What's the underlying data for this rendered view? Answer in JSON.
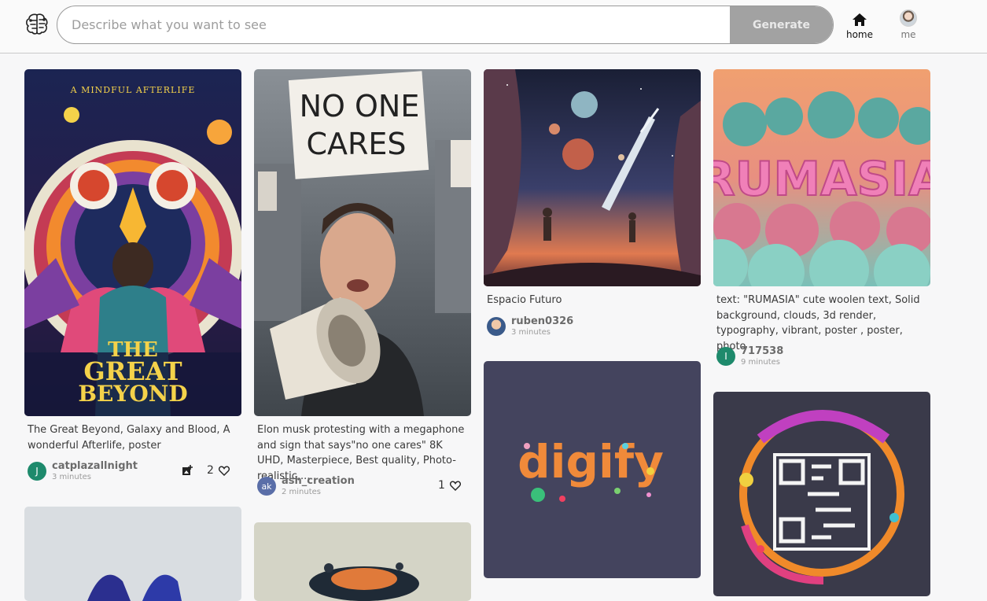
{
  "header": {
    "search_placeholder": "Describe what you want to see",
    "generate_label": "Generate",
    "nav": {
      "home_label": "home",
      "me_label": "me"
    }
  },
  "cards": [
    {
      "caption": "The Great Beyond, Galaxy and Blood, A wonderful Afterlife, poster",
      "user": "catplazallnight",
      "avatar_letter": "J",
      "avatar_color": "#1e8a6c",
      "time": "3 minutes",
      "likes": "2",
      "image_desc": "poster-great-beyond"
    },
    {
      "caption": "Elon musk protesting with a megaphone and sign that says\"no one cares\" 8K UHD, Masterpiece, Best quality, Photo-realistic,...",
      "user": "ash_creation",
      "avatar_letter": "ak",
      "avatar_color": "#5a6ea8",
      "time": "2 minutes",
      "likes": "1",
      "sign_text_1": "NO ONE",
      "sign_text_2": "CARES"
    },
    {
      "caption": "Espacio Futuro",
      "user": "ruben0326",
      "time": "3 minutes"
    },
    {
      "caption": "text: \"RUMASIA\" cute woolen text, Solid background, clouds, 3d render, typography, vibrant, poster , poster, photo",
      "user": "717538",
      "avatar_letter": "I",
      "avatar_color": "#1e8a6c",
      "time": "9 minutes",
      "image_text": "RUMASIA"
    },
    {
      "image_text": "digify"
    }
  ],
  "colors": {
    "accent_green": "#1e8a6c",
    "button_gray": "#a2a2a2"
  }
}
